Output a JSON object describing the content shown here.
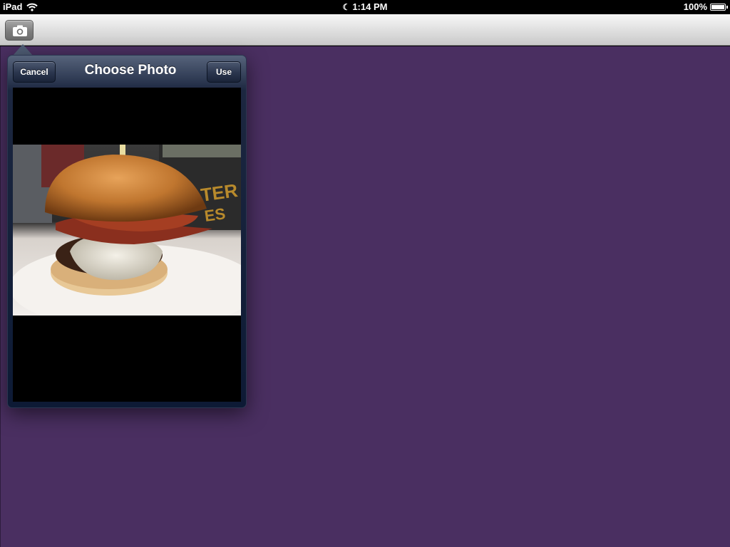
{
  "status_bar": {
    "device": "iPad",
    "time": "1:14 PM",
    "battery": "100%",
    "battery_level": 1.0
  },
  "toolbar": {
    "camera_icon": "camera-icon"
  },
  "popover": {
    "title": "Choose Photo",
    "cancel_label": "Cancel",
    "use_label": "Use"
  },
  "colors": {
    "main_background": "#4a2f61",
    "popover_nav": "#1c2740"
  }
}
